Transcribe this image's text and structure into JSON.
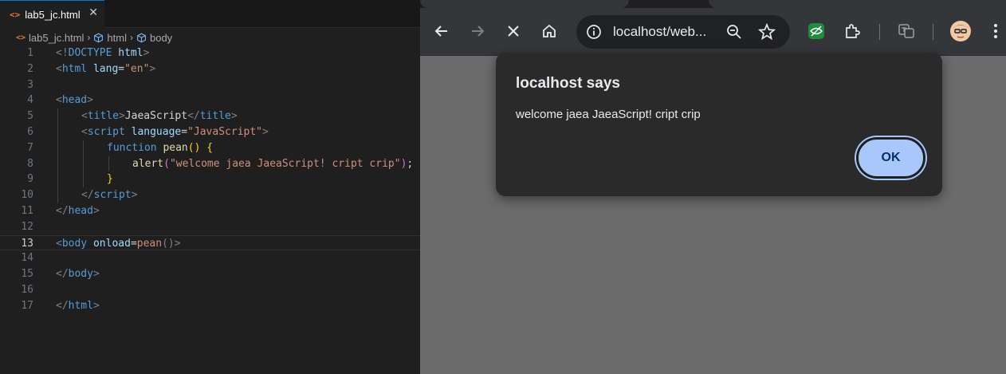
{
  "editor": {
    "tab": {
      "label": "lab5_jc.html",
      "icon": "html-file-icon",
      "close_glyph": "✕"
    },
    "breadcrumb": [
      {
        "label": "lab5_jc.html",
        "icon": "html-file-icon"
      },
      {
        "label": "html",
        "icon": "symbol-element-icon"
      },
      {
        "label": "body",
        "icon": "symbol-element-icon"
      }
    ],
    "current_line": 13,
    "lines": [
      {
        "n": "1",
        "tokens": [
          {
            "t": "<!",
            "c": "tg"
          },
          {
            "t": "DOCTYPE",
            "c": "kw"
          },
          {
            "t": " ",
            "c": "pl"
          },
          {
            "t": "html",
            "c": "at"
          },
          {
            "t": ">",
            "c": "tg"
          }
        ]
      },
      {
        "n": "2",
        "tokens": [
          {
            "t": "<",
            "c": "tg"
          },
          {
            "t": "html",
            "c": "kw"
          },
          {
            "t": " ",
            "c": "pl"
          },
          {
            "t": "lang",
            "c": "at"
          },
          {
            "t": "=",
            "c": "pl"
          },
          {
            "t": "\"en\"",
            "c": "st"
          },
          {
            "t": ">",
            "c": "tg"
          }
        ]
      },
      {
        "n": "3",
        "tokens": []
      },
      {
        "n": "4",
        "tokens": [
          {
            "t": "<",
            "c": "tg"
          },
          {
            "t": "head",
            "c": "kw"
          },
          {
            "t": ">",
            "c": "tg"
          }
        ]
      },
      {
        "n": "5",
        "indent": 1,
        "tokens": [
          {
            "t": "<",
            "c": "tg"
          },
          {
            "t": "title",
            "c": "kw"
          },
          {
            "t": ">",
            "c": "tg"
          },
          {
            "t": "JaeaScript",
            "c": "pl"
          },
          {
            "t": "</",
            "c": "tg"
          },
          {
            "t": "title",
            "c": "kw"
          },
          {
            "t": ">",
            "c": "tg"
          }
        ]
      },
      {
        "n": "6",
        "indent": 1,
        "tokens": [
          {
            "t": "<",
            "c": "tg"
          },
          {
            "t": "script",
            "c": "kw"
          },
          {
            "t": " ",
            "c": "pl"
          },
          {
            "t": "language",
            "c": "at"
          },
          {
            "t": "=",
            "c": "pl"
          },
          {
            "t": "\"JavaScript\"",
            "c": "st"
          },
          {
            "t": ">",
            "c": "tg"
          }
        ]
      },
      {
        "n": "7",
        "indent": 2,
        "tokens": [
          {
            "t": "function",
            "c": "kw"
          },
          {
            "t": " ",
            "c": "pl"
          },
          {
            "t": "pean",
            "c": "fn"
          },
          {
            "t": "()",
            "c": "br1"
          },
          {
            "t": " ",
            "c": "pl"
          },
          {
            "t": "{",
            "c": "br1"
          }
        ]
      },
      {
        "n": "8",
        "indent": 3,
        "tokens": [
          {
            "t": "alert",
            "c": "fn"
          },
          {
            "t": "(",
            "c": "br2"
          },
          {
            "t": "\"welcome jaea JaeaScript! cript crip\"",
            "c": "st"
          },
          {
            "t": ")",
            "c": "br2"
          },
          {
            "t": ";",
            "c": "pl"
          }
        ]
      },
      {
        "n": "9",
        "indent": 2,
        "tokens": [
          {
            "t": "}",
            "c": "br1"
          }
        ]
      },
      {
        "n": "10",
        "indent": 1,
        "tokens": [
          {
            "t": "</",
            "c": "tg"
          },
          {
            "t": "script",
            "c": "kw"
          },
          {
            "t": ">",
            "c": "tg"
          }
        ]
      },
      {
        "n": "11",
        "tokens": [
          {
            "t": "</",
            "c": "tg"
          },
          {
            "t": "head",
            "c": "kw"
          },
          {
            "t": ">",
            "c": "tg"
          }
        ]
      },
      {
        "n": "12",
        "tokens": []
      },
      {
        "n": "13",
        "tokens": [
          {
            "t": "<",
            "c": "tg"
          },
          {
            "t": "body",
            "c": "kw"
          },
          {
            "t": " ",
            "c": "pl"
          },
          {
            "t": "onload",
            "c": "at"
          },
          {
            "t": "=",
            "c": "pl"
          },
          {
            "t": "pean",
            "c": "st"
          },
          {
            "t": "()",
            "c": "tg"
          },
          {
            "t": ">",
            "c": "tg"
          }
        ]
      },
      {
        "n": "14",
        "tokens": []
      },
      {
        "n": "15",
        "tokens": [
          {
            "t": "</",
            "c": "tg"
          },
          {
            "t": "body",
            "c": "kw"
          },
          {
            "t": ">",
            "c": "tg"
          }
        ]
      },
      {
        "n": "16",
        "tokens": []
      },
      {
        "n": "17",
        "tokens": [
          {
            "t": "</",
            "c": "tg"
          },
          {
            "t": "html",
            "c": "kw"
          },
          {
            "t": ">",
            "c": "tg"
          }
        ]
      }
    ]
  },
  "browser": {
    "toolbar": {
      "back_icon": "back-arrow-icon",
      "forward_icon": "forward-arrow-icon",
      "stop_icon": "stop-loading-icon",
      "home_icon": "home-icon",
      "site_info_icon": "site-info-icon",
      "url": "localhost/web...",
      "zoom_icon": "zoom-out-icon",
      "bookmark_icon": "star-bookmark-icon",
      "extensions": [
        "eye-extension-icon",
        "puzzle-extensions-icon",
        "translate-icon"
      ],
      "profile_icon": "profile-avatar-icon",
      "menu_icon": "kebab-menu-icon"
    },
    "dialog": {
      "title": "localhost says",
      "message": "welcome jaea JaeaScript! cript crip",
      "ok_label": "OK"
    }
  },
  "colors": {
    "editor_bg": "#1f1f1f",
    "accent_blue": "#0078d4",
    "dialog_bg": "#2a2a2b",
    "ok_button": "#a8c7fa",
    "page_bg": "#6b6b6b"
  }
}
